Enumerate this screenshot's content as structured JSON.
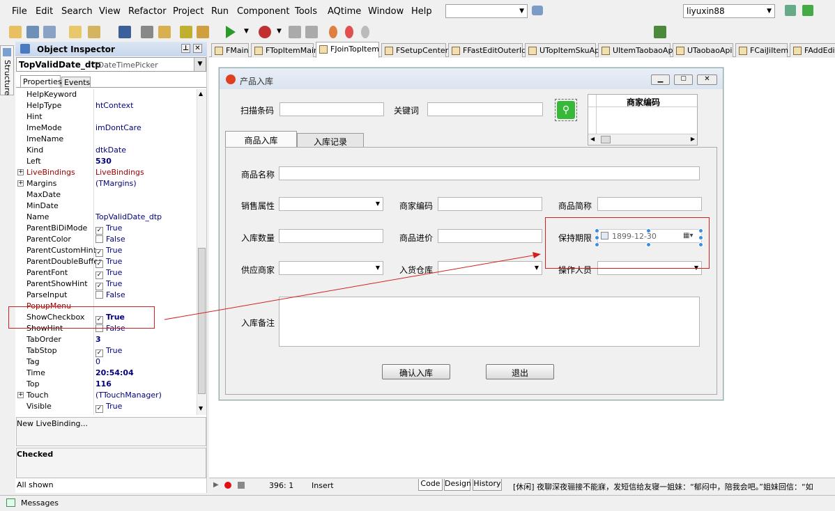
{
  "menu": {
    "items": [
      "File",
      "Edit",
      "Search",
      "View",
      "Refactor",
      "Project",
      "Run",
      "Component",
      "Tools",
      "AQtime",
      "Window",
      "Help"
    ]
  },
  "user_combo": "liyuxin88",
  "structure_tab": "Structure",
  "inspector": {
    "title": "Object Inspector",
    "component": "TopValidDate_dtp",
    "component_type": "TDateTimePicker",
    "tabs": [
      "Properties",
      "Events"
    ],
    "rows": [
      {
        "name": "HelpKeyword",
        "value": "",
        "cb": false
      },
      {
        "name": "HelpType",
        "value": "htContext",
        "cb": false
      },
      {
        "name": "Hint",
        "value": "",
        "cb": false
      },
      {
        "name": "ImeMode",
        "value": "imDontCare",
        "cb": false
      },
      {
        "name": "ImeName",
        "value": "",
        "cb": false
      },
      {
        "name": "Kind",
        "value": "dtkDate",
        "cb": false
      },
      {
        "name": "Left",
        "value": "530",
        "cb": false,
        "bold": true
      },
      {
        "name": "LiveBindings",
        "value": "LiveBindings",
        "cb": false,
        "red": true,
        "expand": true
      },
      {
        "name": "Margins",
        "value": "(TMargins)",
        "cb": false,
        "expand": true
      },
      {
        "name": "MaxDate",
        "value": "",
        "cb": false
      },
      {
        "name": "MinDate",
        "value": "",
        "cb": false
      },
      {
        "name": "Name",
        "value": "TopValidDate_dtp",
        "cb": false
      },
      {
        "name": "ParentBiDiMode",
        "value": "True",
        "cb": true,
        "checked": true
      },
      {
        "name": "ParentColor",
        "value": "False",
        "cb": true,
        "checked": false
      },
      {
        "name": "ParentCustomHint",
        "value": "True",
        "cb": true,
        "checked": true
      },
      {
        "name": "ParentDoubleBuffer",
        "value": "True",
        "cb": true,
        "checked": true
      },
      {
        "name": "ParentFont",
        "value": "True",
        "cb": true,
        "checked": true
      },
      {
        "name": "ParentShowHint",
        "value": "True",
        "cb": true,
        "checked": true
      },
      {
        "name": "ParseInput",
        "value": "False",
        "cb": true,
        "checked": false
      },
      {
        "name": "PopupMenu",
        "value": "",
        "cb": false,
        "red": true
      },
      {
        "name": "ShowCheckbox",
        "value": "True",
        "cb": true,
        "checked": true,
        "bold": true
      },
      {
        "name": "ShowHint",
        "value": "False",
        "cb": true,
        "checked": false
      },
      {
        "name": "TabOrder",
        "value": "3",
        "cb": false,
        "bold": true
      },
      {
        "name": "TabStop",
        "value": "True",
        "cb": true,
        "checked": true
      },
      {
        "name": "Tag",
        "value": "0",
        "cb": false
      },
      {
        "name": "Time",
        "value": "20:54:04",
        "cb": false,
        "bold": true
      },
      {
        "name": "Top",
        "value": "116",
        "cb": false,
        "bold": true
      },
      {
        "name": "Touch",
        "value": "(TTouchManager)",
        "cb": false,
        "expand": true
      },
      {
        "name": "Visible",
        "value": "True",
        "cb": true,
        "checked": true
      }
    ],
    "new_livebinding": "New LiveBinding...",
    "desc": "Checked",
    "all_shown": "All shown"
  },
  "unit_tabs": [
    "FMain",
    "FTopItemMain",
    "FJoinTopItem",
    "FSetupCenter",
    "FFastEditOuterId",
    "UTopItemSkuApi",
    "UItemTaobaoApi",
    "UTaobaoApi",
    "FCaiJiItem",
    "FAddEdit"
  ],
  "active_tab": "FJoinTopItem",
  "form": {
    "caption": "产品入库",
    "scan_label": "扫描条码",
    "keyword_label": "关键词",
    "grid_header": "商家编码",
    "tabs": [
      "商品入库",
      "入库记录"
    ],
    "name_label": "商品名称",
    "sale_attr_label": "销售属性",
    "merchant_code_label": "商家编码",
    "short_name_label": "商品简称",
    "qty_label": "入库数量",
    "price_label": "商品进价",
    "shelf_label": "保持期限",
    "date_value": "1899-12-30",
    "supplier_label": "供应商家",
    "warehouse_label": "入货仓库",
    "operator_label": "操作人员",
    "remark_label": "入库备注",
    "confirm_btn": "确认入库",
    "exit_btn": "退出"
  },
  "status": {
    "pos": "396:   1",
    "mode": "Insert",
    "tabs": [
      "Code",
      "Design",
      "History"
    ],
    "ticker": "[休闲] 夜聊深夜骊接不能寐，发短信给友寝一姐妹：“郁闷中，陪我会吧。”姐妹回信：“如"
  },
  "messages": "Messages"
}
